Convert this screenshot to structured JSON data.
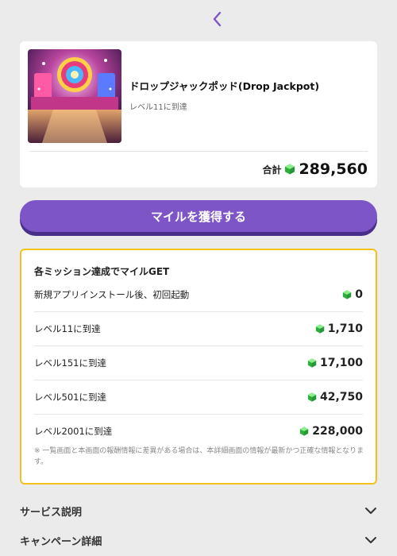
{
  "header": {
    "back_icon": "chevron-left-icon",
    "accent": "#7d55c6"
  },
  "app": {
    "title": "ドロップジャックポッド(Drop Jackpot)",
    "subtitle": "レベル11に到達",
    "total_label": "合計",
    "total_value": "289,560"
  },
  "cta": {
    "label": "マイルを獲得する"
  },
  "missions": {
    "heading": "各ミッション達成でマイルGET",
    "items": [
      {
        "label": "新規アプリインストール後、初回起動",
        "value": "0"
      },
      {
        "label": "レベル11に到達",
        "value": "1,710"
      },
      {
        "label": "レベル151に到達",
        "value": "17,100"
      },
      {
        "label": "レベル501に到達",
        "value": "42,750"
      },
      {
        "label": "レベル2001に到達",
        "value": "228,000"
      }
    ],
    "note": "※ 一覧画面と本画面の報酬情報に差異がある場合は、本詳細画面の情報が最新かつ正確な情報となります。"
  },
  "sections": [
    {
      "label": "サービス説明"
    },
    {
      "label": "キャンペーン詳細"
    }
  ],
  "colors": {
    "border_yellow": "#f1c11e",
    "gem_green": "#3fcf4f",
    "button": "#7d55c6"
  }
}
